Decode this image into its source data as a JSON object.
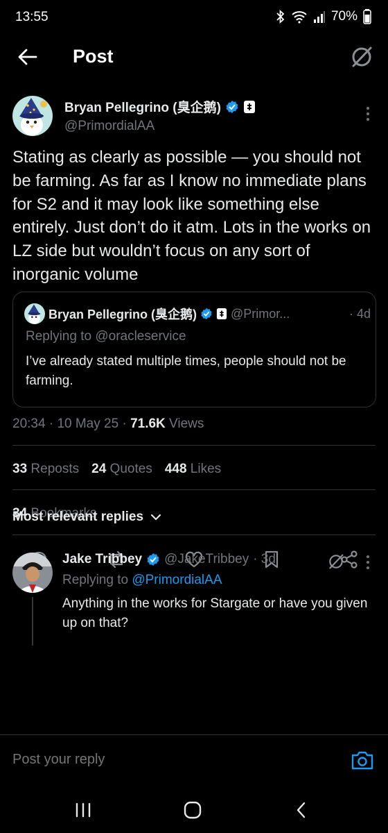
{
  "status_bar": {
    "time": "13:55",
    "battery": "70%"
  },
  "header": {
    "title": "Post"
  },
  "post": {
    "author_name": "Bryan Pellegrino (臭企鹅)",
    "handle": "@PrimordialAA",
    "text": "Stating as clearly as possible — you should not be farming. As far as I know no immediate plans for S2 and it may look like something else entirely. Just don’t do it atm. Lots in the works on LZ side but wouldn’t focus on any sort of inorganic volume",
    "quoted": {
      "author_name": "Bryan Pellegrino (臭企鹅)",
      "handle": "@Primor...",
      "age": "· 4d",
      "replying_to": "Replying to @oracleservice",
      "text": "I’ve already stated multiple times, people should not be farming."
    },
    "time": "20:34",
    "date": "10 May 25",
    "views_count": "71.6K",
    "views_label": "Views",
    "reposts_count": "33",
    "reposts_label": "Reposts",
    "quotes_count": "24",
    "quotes_label": "Quotes",
    "likes_count": "448",
    "likes_label": "Likes",
    "bookmarks_count": "34",
    "bookmarks_label": "Bookmarks"
  },
  "replies": {
    "heading": "Most relevant replies",
    "items": [
      {
        "author_name": "Jake Tribbey",
        "handle": "@JakeTribbey",
        "age": "· 3d",
        "replying_prefix": "Replying to",
        "replying_handle": "@PrimordialAA",
        "text": "Anything in the works for Stargate or have you given up on that?"
      }
    ]
  },
  "composer": {
    "placeholder": "Post your reply"
  },
  "colors": {
    "accent": "#1d9bf0",
    "muted": "#71767b",
    "background": "#000000",
    "text": "#e7e9ea"
  }
}
